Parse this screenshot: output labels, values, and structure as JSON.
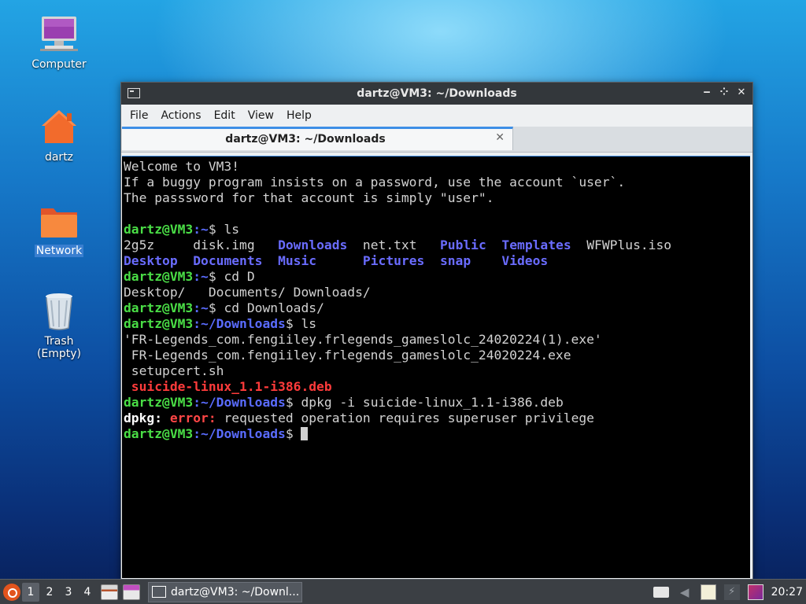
{
  "desktop": {
    "icons": [
      {
        "label": "Computer"
      },
      {
        "label": "dartz"
      },
      {
        "label": "Network"
      },
      {
        "label": "Trash (Empty)"
      }
    ]
  },
  "window": {
    "title": "dartz@VM3: ~/Downloads",
    "menu": [
      "File",
      "Actions",
      "Edit",
      "View",
      "Help"
    ],
    "tab_title": "dartz@VM3: ~/Downloads",
    "buttons": {
      "minimize": "‒",
      "maximize": "⁘",
      "close": "✕"
    }
  },
  "terminal": {
    "motd": [
      "Welcome to VM3!",
      "If a buggy program insists on a password, use the account `user`.",
      "The passsword for that account is simply \"user\"."
    ],
    "prompt_user": "dartz@VM3",
    "home_path": ":~",
    "dl_path": ":~/Downloads",
    "dollar": "$ ",
    "cmd1": "ls",
    "ls_row1": [
      "2g5z",
      "disk.img",
      "Downloads",
      "net.txt",
      "Public",
      "Templates",
      "WFWPlus.iso"
    ],
    "ls_row2": [
      "Desktop",
      "Documents",
      "Music",
      "Pictures",
      "snap",
      "Videos"
    ],
    "cmd2": "cd D",
    "completion": "Desktop/   Documents/ Downloads/",
    "cmd3": "cd Downloads/",
    "cmd4": "ls",
    "files": [
      "'FR-Legends_com.fengiiley.frlegends_gameslolc_24020224(1).exe'",
      " FR-Legends_com.fengiiley.frlegends_gameslolc_24020224.exe",
      " setupcert.sh",
      " suicide-linux_1.1-i386.deb"
    ],
    "cmd5": "dpkg -i suicide-linux_1.1-i386.deb",
    "err_prog": "dpkg:",
    "err_word": "error:",
    "err_msg": "requested operation requires superuser privilege"
  },
  "taskbar": {
    "workspaces": [
      "1",
      "2",
      "3",
      "4"
    ],
    "task_label": "dartz@VM3: ~/Downl...",
    "clock": "20:27"
  },
  "colors": {
    "prompt_green": "#4ade46",
    "path_blue": "#5a6cff",
    "error_red": "#ff4646",
    "tab_accent": "#3d8ee6"
  }
}
